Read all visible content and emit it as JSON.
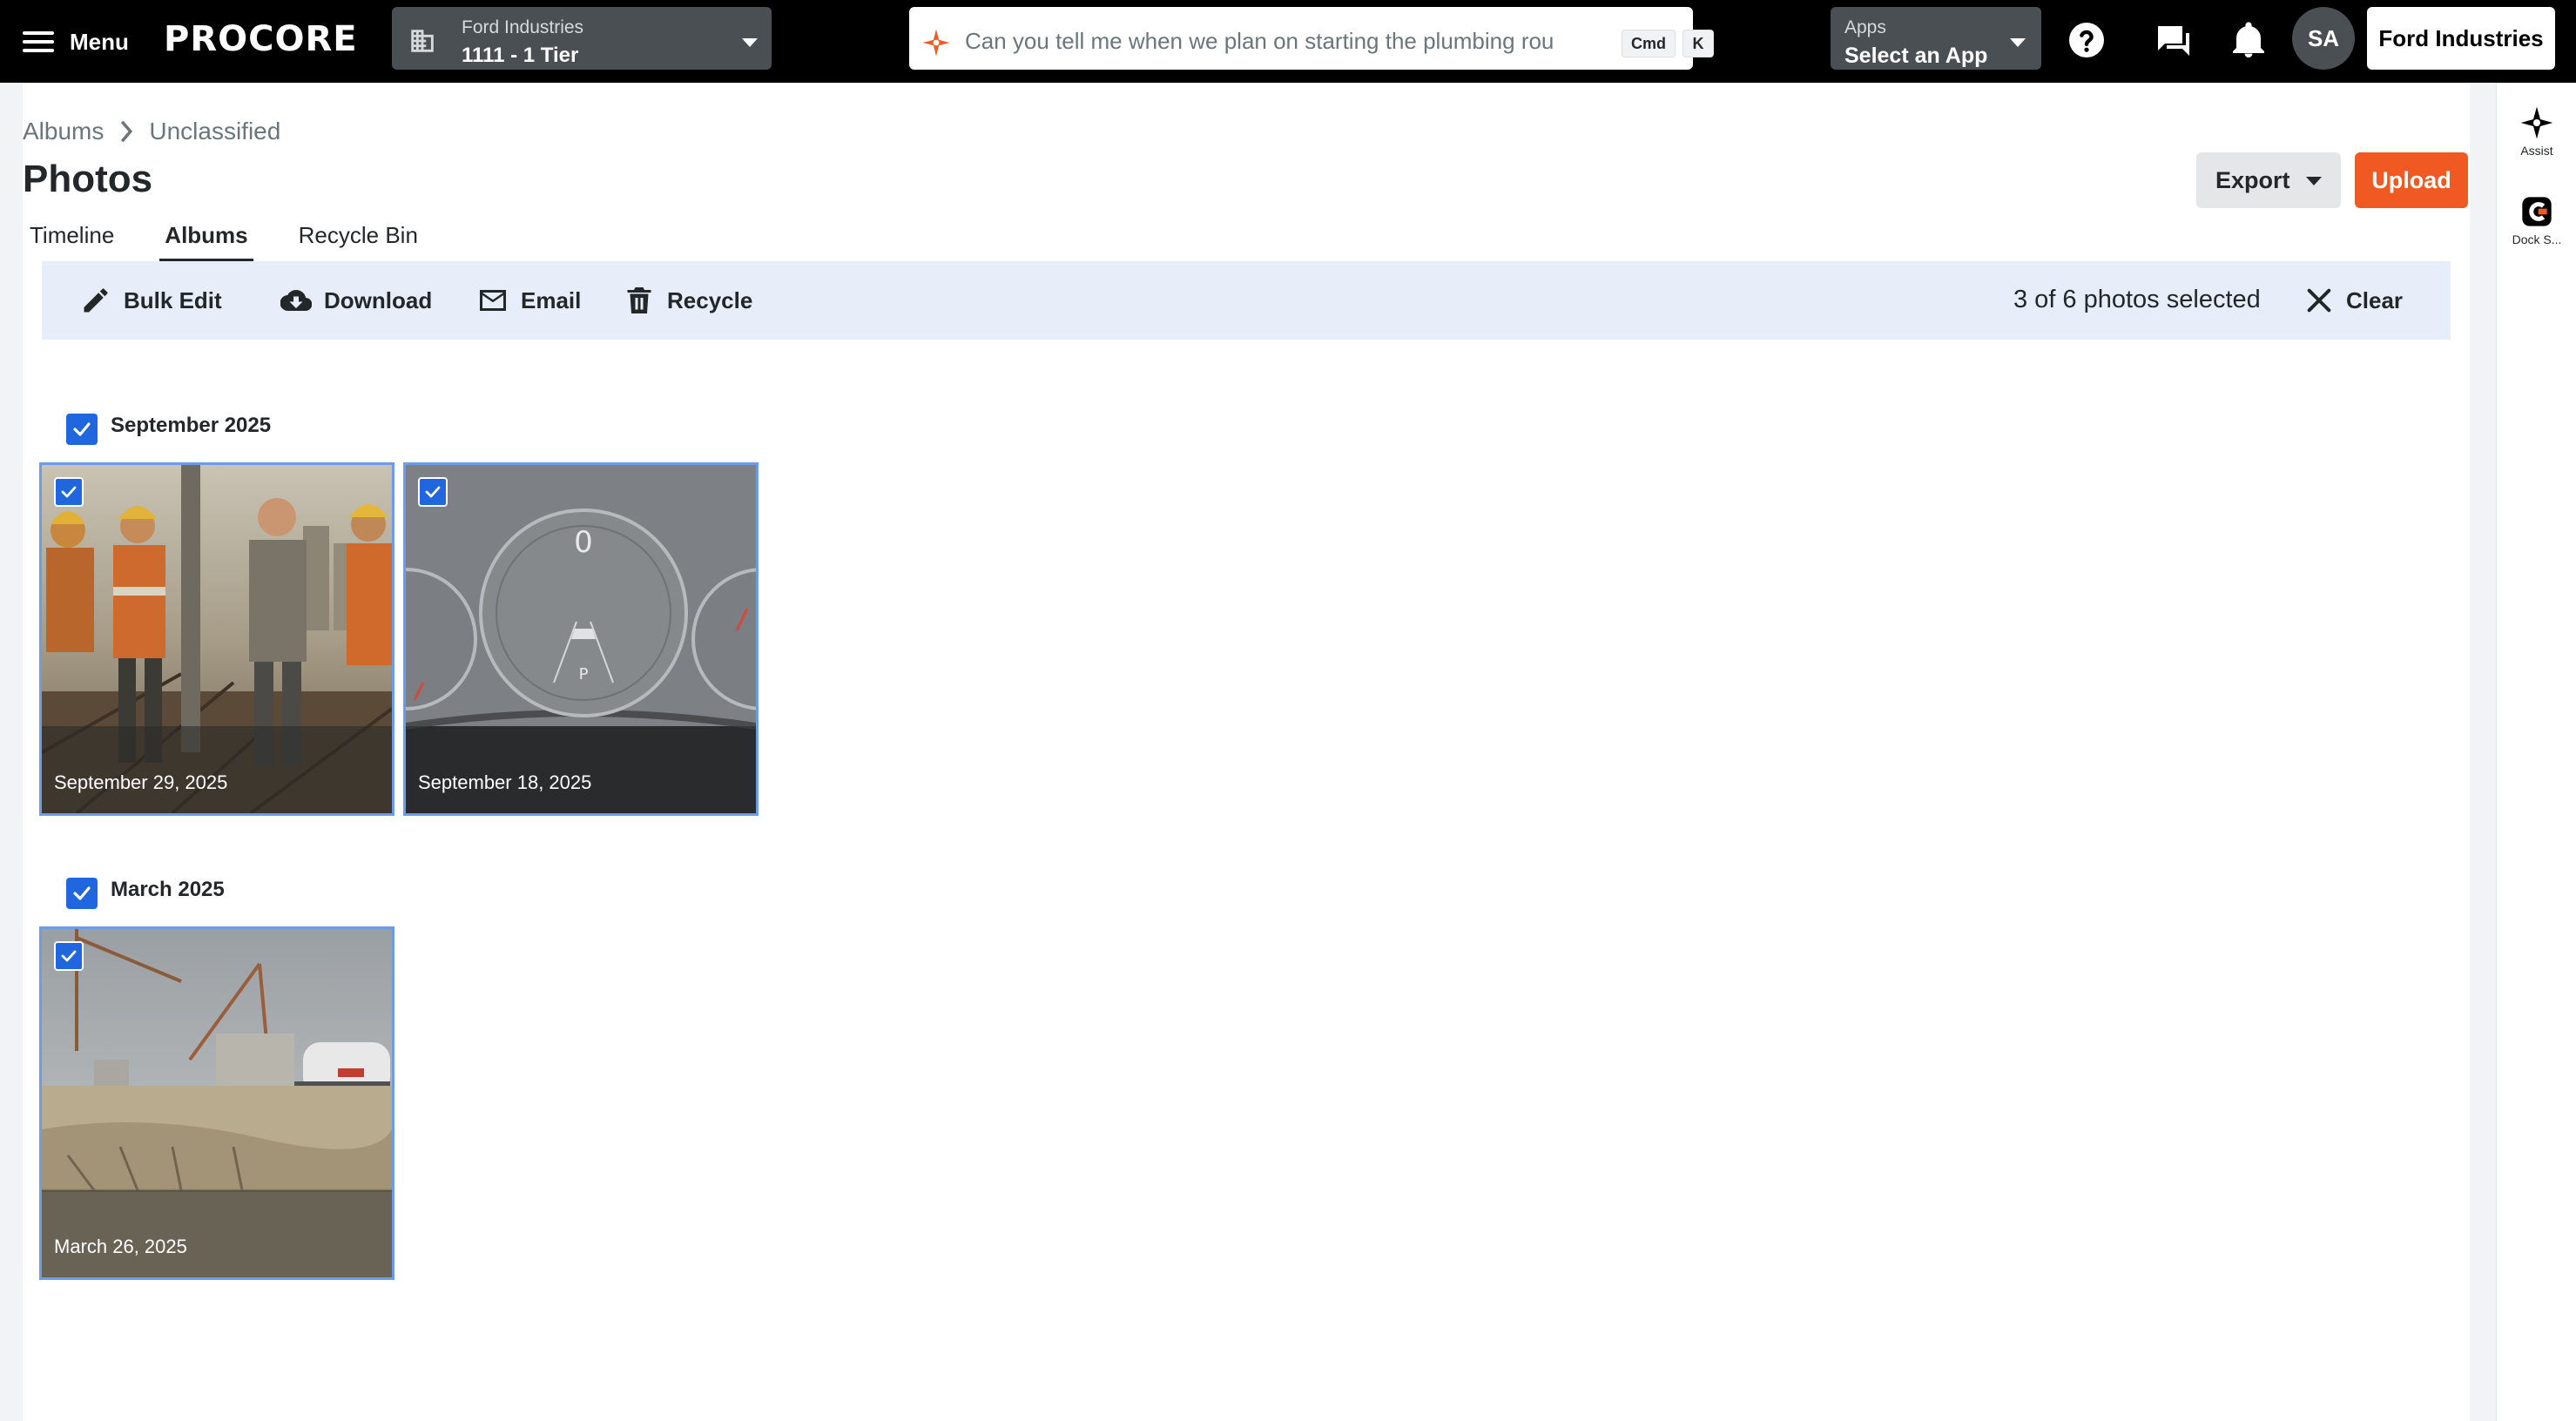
{
  "topnav": {
    "menu_label": "Menu",
    "logo_text": "PROCORE",
    "project_company": "Ford Industries",
    "project_name": "1111 - 1 Tier",
    "search_placeholder": "Can you tell me when we plan on starting the plumbing rou",
    "search_kbd_cmd": "Cmd",
    "search_kbd_k": "K",
    "apps_label": "Apps",
    "apps_value": "Select an App",
    "avatar_initials": "SA",
    "company_button": "Ford Industries"
  },
  "right_rail": {
    "assist_label": "Assist",
    "dock_label": "Dock S..."
  },
  "breadcrumb": {
    "root": "Albums",
    "current": "Unclassified"
  },
  "page": {
    "title": "Photos",
    "export_label": "Export",
    "upload_label": "Upload"
  },
  "tabs": [
    {
      "label": "Timeline",
      "active": false
    },
    {
      "label": "Albums",
      "active": true
    },
    {
      "label": "Recycle Bin",
      "active": false
    }
  ],
  "action_bar": {
    "bulk_edit": "Bulk Edit",
    "download": "Download",
    "email": "Email",
    "recycle": "Recycle",
    "selection_text": "3 of 6 photos selected",
    "clear": "Clear"
  },
  "groups": [
    {
      "title": "September 2025",
      "checked": true,
      "photos": [
        {
          "date": "September 29, 2025",
          "checked": true,
          "scene": "workers"
        },
        {
          "date": "September 18, 2025",
          "checked": true,
          "scene": "dashboard"
        }
      ]
    },
    {
      "title": "March 2025",
      "checked": true,
      "photos": [
        {
          "date": "March 26, 2025",
          "checked": true,
          "scene": "site"
        }
      ]
    }
  ],
  "colors": {
    "brand_orange": "#f05a22",
    "selection_blue": "#2066df",
    "action_bar_bg": "#e8eef9",
    "nav_bg": "#000000"
  }
}
